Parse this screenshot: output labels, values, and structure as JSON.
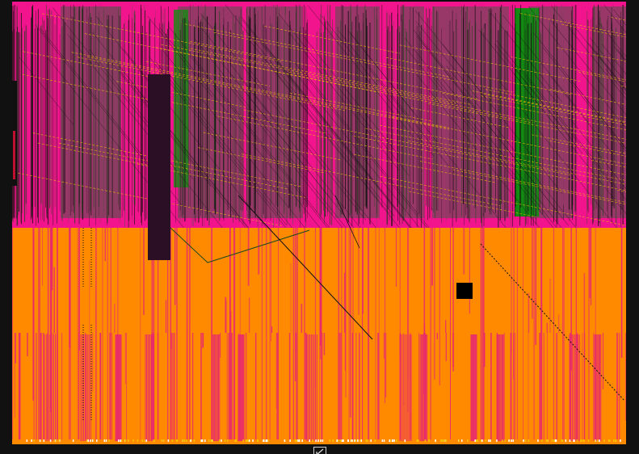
{
  "app": {
    "view": "ic-layout-viewer",
    "colors": {
      "background": "#0d0d0d",
      "upper_region": "#f2148c",
      "upper_region_dark": "#8a3d63",
      "lower_region": "#ff8a00",
      "lower_stripes": "#e8286f",
      "green_block": "#138a12",
      "dark_green": "#1d4a1d",
      "yellow_trace": "#f2c200",
      "black_trace": "#101010",
      "macro_block": "#2a0f25",
      "pad": "#000000"
    }
  },
  "toolbar": {
    "corner_widget_icon": "resize-corner-icon"
  }
}
